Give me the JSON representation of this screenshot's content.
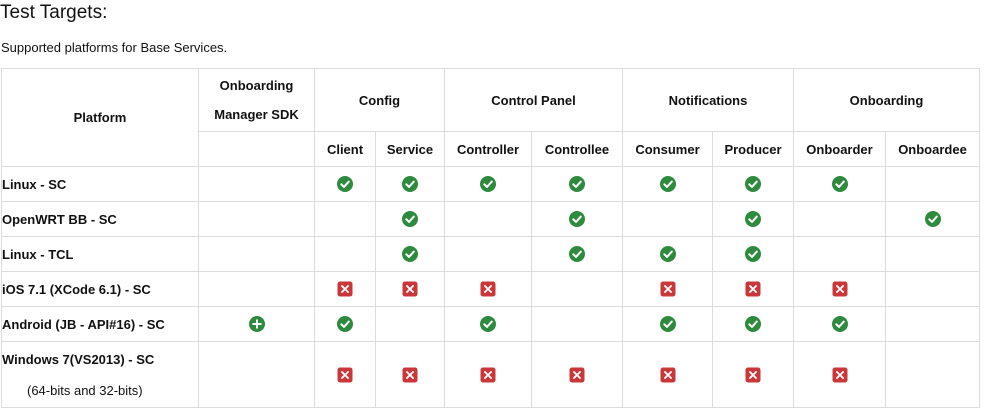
{
  "title": "Test Targets:",
  "subtitle": "Supported platforms for Base Services.",
  "colors": {
    "check": "#2e8b3e",
    "cross": "#c9373a",
    "plus": "#2e8b3e",
    "border": "#dcdcdc"
  },
  "table": {
    "platform_header": "Platform",
    "groups": [
      {
        "line1": "Onboarding",
        "line2": "Manager SDK"
      },
      {
        "label": "Config"
      },
      {
        "label": "Control Panel"
      },
      {
        "label": "Notifications"
      },
      {
        "label": "Onboarding"
      }
    ],
    "subheaders": [
      "Client",
      "Service",
      "Controller",
      "Controllee",
      "Consumer",
      "Producer",
      "Onboarder",
      "Onboardee"
    ],
    "rows": [
      {
        "platform": "Linux - SC",
        "note": "",
        "cells": [
          "",
          "check",
          "check",
          "check",
          "check",
          "check",
          "check",
          "check",
          ""
        ]
      },
      {
        "platform": "OpenWRT BB - SC",
        "note": "",
        "cells": [
          "",
          "",
          "check",
          "",
          "check",
          "",
          "check",
          "",
          "check"
        ]
      },
      {
        "platform": "Linux - TCL",
        "note": "",
        "cells": [
          "",
          "",
          "check",
          "",
          "check",
          "check",
          "check",
          "",
          ""
        ]
      },
      {
        "platform": "iOS 7.1 (XCode 6.1) - SC",
        "note": "",
        "cells": [
          "",
          "cross",
          "cross",
          "cross",
          "",
          "cross",
          "cross",
          "cross",
          ""
        ]
      },
      {
        "platform": "Android (JB - API#16) - SC",
        "note": "",
        "cells": [
          "plus",
          "check",
          "",
          "check",
          "",
          "check",
          "check",
          "check",
          ""
        ]
      },
      {
        "platform": "Windows 7(VS2013) - SC",
        "note": "(64-bits and 32-bits)",
        "cells": [
          "",
          "cross",
          "cross",
          "cross",
          "cross",
          "cross",
          "cross",
          "cross",
          ""
        ]
      }
    ]
  }
}
